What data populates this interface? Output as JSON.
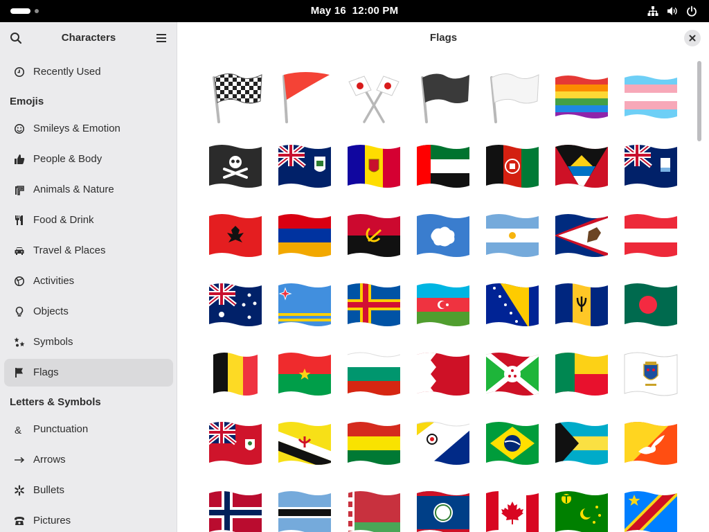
{
  "status_bar": {
    "date": "May 16",
    "time": "12:00 PM",
    "icons": [
      "network-icon",
      "volume-icon",
      "power-icon"
    ]
  },
  "sidebar": {
    "title": "Characters",
    "search_icon": "search-icon",
    "menu_icon": "menu-icon",
    "recent": {
      "label": "Recently Used",
      "icon": "clock-icon"
    },
    "sections": [
      {
        "title": "Emojis",
        "items": [
          {
            "label": "Smileys & Emotion",
            "icon": "smiley-icon"
          },
          {
            "label": "People & Body",
            "icon": "thumbs-up-icon"
          },
          {
            "label": "Animals & Nature",
            "icon": "plant-icon"
          },
          {
            "label": "Food & Drink",
            "icon": "cutlery-icon"
          },
          {
            "label": "Travel & Places",
            "icon": "car-icon"
          },
          {
            "label": "Activities",
            "icon": "ball-icon"
          },
          {
            "label": "Objects",
            "icon": "lightbulb-icon"
          },
          {
            "label": "Symbols",
            "icon": "symbols-icon"
          },
          {
            "label": "Flags",
            "icon": "flag-icon",
            "selected": true
          }
        ]
      },
      {
        "title": "Letters & Symbols",
        "items": [
          {
            "label": "Punctuation",
            "icon": "ampersand-icon"
          },
          {
            "label": "Arrows",
            "icon": "arrow-right-icon"
          },
          {
            "label": "Bullets",
            "icon": "asterisk-icon"
          },
          {
            "label": "Pictures",
            "icon": "telephone-icon"
          }
        ]
      }
    ]
  },
  "content": {
    "title": "Flags",
    "close_icon": "close-icon",
    "flags": [
      "chequered-flag",
      "triangular-flag",
      "crossed-flags",
      "black-flag",
      "white-flag",
      "rainbow-flag",
      "transgender-flag",
      "pirate-flag",
      "flag-ascension-island",
      "flag-andorra",
      "flag-united-arab-emirates",
      "flag-afghanistan",
      "flag-antigua-barbuda",
      "flag-anguilla",
      "flag-albania",
      "flag-armenia",
      "flag-angola",
      "flag-antarctica",
      "flag-argentina",
      "flag-american-samoa",
      "flag-austria",
      "flag-australia",
      "flag-aruba",
      "flag-aland-islands",
      "flag-azerbaijan",
      "flag-bosnia-herzegovina",
      "flag-barbados",
      "flag-bangladesh",
      "flag-belgium",
      "flag-burkina-faso",
      "flag-bulgaria",
      "flag-bahrain",
      "flag-burundi",
      "flag-benin",
      "flag-st-barthelemy",
      "flag-bermuda",
      "flag-brunei",
      "flag-bolivia",
      "flag-caribbean-netherlands",
      "flag-brazil",
      "flag-bahamas",
      "flag-bhutan",
      "flag-bouvet-island",
      "flag-botswana",
      "flag-belarus",
      "flag-belize",
      "flag-canada",
      "flag-cocos-islands",
      "flag-congo-kinshasa"
    ]
  }
}
